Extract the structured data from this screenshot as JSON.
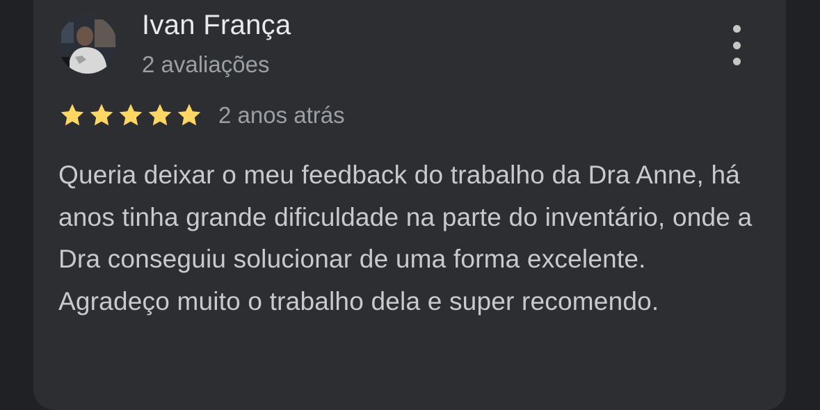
{
  "review": {
    "reviewer_name": "Ivan França",
    "review_count": "2 avaliações",
    "rating": 5,
    "max_rating": 5,
    "date": "2 anos atrás",
    "text": "Queria deixar o meu feedback do trabalho da Dra Anne, há anos tinha grande dificuldade na parte do inventário, onde a Dra conseguiu solucionar de uma forma excelente. Agradeço muito o trabalho dela e super recomendo."
  },
  "icons": {
    "more": "more-vert-icon",
    "star": "star-icon",
    "avatar": "user-avatar"
  },
  "colors": {
    "background": "#202124",
    "card": "#2d2e31",
    "star": "#fdd663",
    "name": "#e8eaed",
    "secondary": "#9aa0a6",
    "body": "#c8cacd"
  }
}
